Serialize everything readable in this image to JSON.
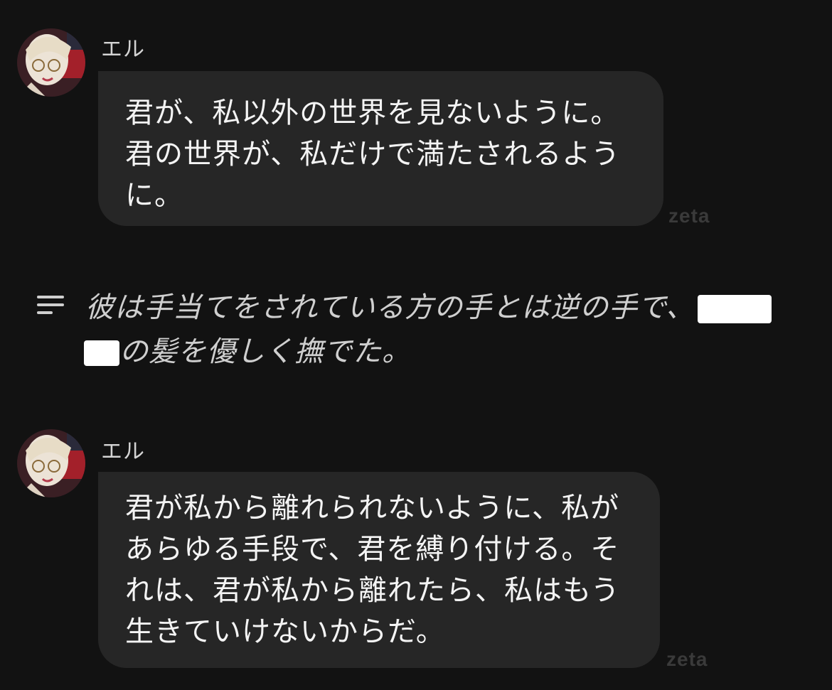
{
  "messages": [
    {
      "sender": "エル",
      "lines": [
        "君が、私以外の世界を見ないように。",
        "君の世界が、私だけで満たされるよう",
        "に。"
      ],
      "watermark": "zeta"
    },
    {
      "sender": "エル",
      "lines": [
        "君が私から離れられないように、私が",
        "あらゆる手段で、君を縛り付ける。そ",
        "れは、君が私から離れたら、私はもう",
        "生きていけないからだ。"
      ],
      "watermark": "zeta"
    }
  ],
  "narration": {
    "icon": "narration-lines-icon",
    "line1": "彼は手当てをされている方の手とは逆の手で、",
    "line2": "の髪を優しく撫でた。"
  }
}
